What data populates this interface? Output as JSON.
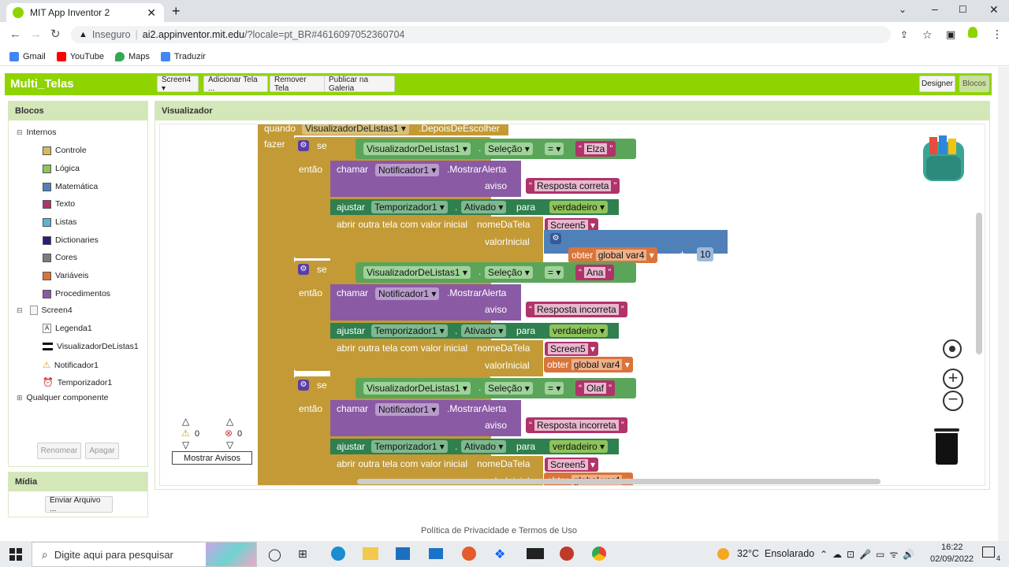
{
  "browser": {
    "tab_title": "MIT App Inventor 2",
    "security": "Inseguro",
    "url_host": "ai2.appinventor.mit.edu",
    "url_rest": "/?locale=pt_BR#4616097052360704",
    "bookmarks": [
      "Gmail",
      "YouTube",
      "Maps",
      "Traduzir"
    ]
  },
  "app": {
    "title": "Multi_Telas",
    "screen_select": "Screen4 ▾",
    "add_screen": "Adicionar Tela ...",
    "remove_screen": "Remover Tela",
    "publish": "Publicar na Galeria",
    "designer": "Designer",
    "blocks": "Blocos"
  },
  "blocks_panel": {
    "title": "Blocos",
    "internos": "Internos",
    "builtin": [
      {
        "label": "Controle",
        "color": "#d9b85a"
      },
      {
        "label": "Lógica",
        "color": "#8fc35b"
      },
      {
        "label": "Matemática",
        "color": "#4f80b8"
      },
      {
        "label": "Texto",
        "color": "#b0336a"
      },
      {
        "label": "Listas",
        "color": "#55b6d6"
      },
      {
        "label": "Dictionaries",
        "color": "#2c1a80"
      },
      {
        "label": "Cores",
        "color": "#7c7c7c"
      },
      {
        "label": "Variáveis",
        "color": "#d9743a"
      },
      {
        "label": "Procedimentos",
        "color": "#8a5aa5"
      }
    ],
    "screen": "Screen4",
    "components": [
      "Legenda1",
      "VisualizadorDeListas1",
      "Notificador1",
      "Temporizador1"
    ],
    "any": "Qualquer componente",
    "rename": "Renomear",
    "delete": "Apagar"
  },
  "media": {
    "title": "Mídia",
    "upload": "Enviar Arquivo ..."
  },
  "viewer": {
    "title": "Visualizador",
    "warnings_count": "0",
    "errors_count": "0",
    "show_warnings": "Mostrar Avisos"
  },
  "code": {
    "when": "quando",
    "event_component": "VisualizadorDeListas1",
    "event_name": ".DepoisDeEscolher",
    "do": "fazer",
    "if": "se",
    "then": "então",
    "call": "chamar",
    "notifier": "Notificador1",
    "show_alert": ".MostrarAlerta",
    "notice": "aviso",
    "set": "ajustar",
    "timer": "Temporizador1",
    "enabled": "Ativado",
    "to": "para",
    "true_val": "verdadeiro",
    "open_screen": "abrir outra tela com valor inicial",
    "screen_name_label": "nomeDaTela",
    "start_value_label": "valorInicial",
    "list_component": "VisualizadorDeListas1",
    "selection": "Seleção",
    "eq": "=",
    "get": "obter",
    "var": "global var4",
    "plus": "+",
    "num": "10",
    "target_screen": "Screen5",
    "branches": [
      {
        "name": "Elza",
        "message": "Resposta correta"
      },
      {
        "name": "Ana",
        "message": "Resposta incorreta"
      },
      {
        "name": "Olaf",
        "message": "Resposta incorreta"
      }
    ]
  },
  "footer": "Política de Privacidade e Termos de Uso",
  "taskbar": {
    "search_placeholder": "Digite aqui para pesquisar",
    "weather": "32°C  Ensolarado",
    "time": "16:22",
    "date": "02/09/2022",
    "notif_count": "4"
  }
}
